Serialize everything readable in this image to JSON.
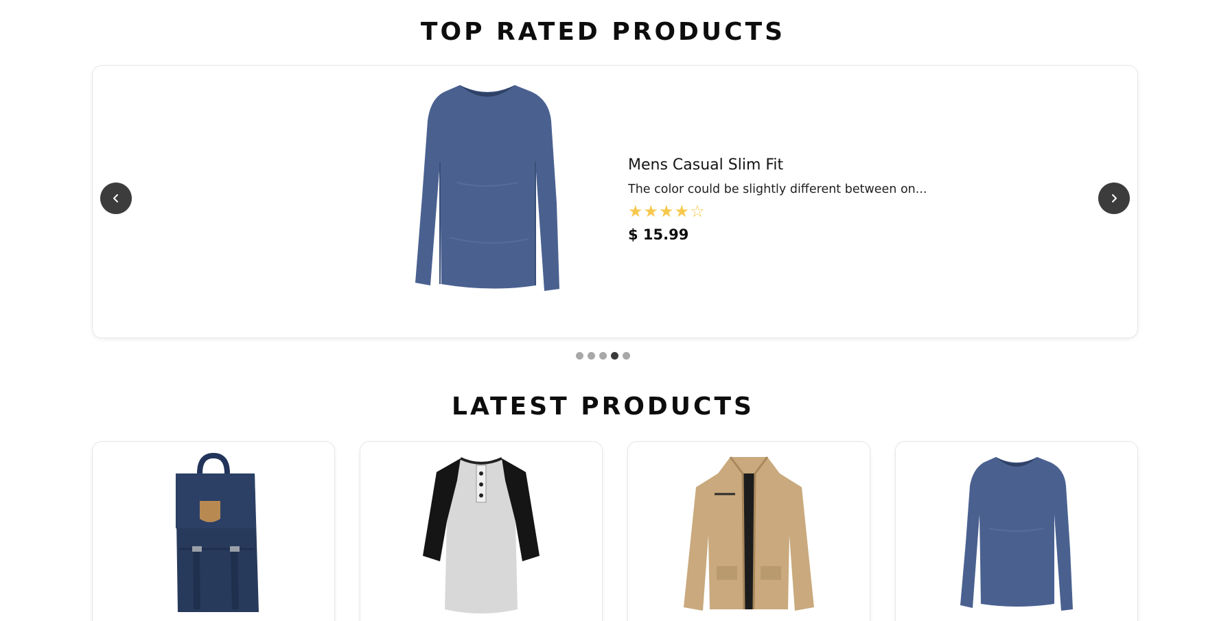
{
  "sections": {
    "top_rated_title": "TOP RATED PRODUCTS",
    "latest_title": "LATEST PRODUCTS"
  },
  "carousel": {
    "product": {
      "name": "Mens Casual Slim Fit",
      "description": "The color could be slightly different between on...",
      "price": "$ 15.99",
      "rating": 4,
      "rating_max": 5,
      "image_icon": "long-sleeve-tshirt-image"
    },
    "prev_icon": "chevron-left-icon",
    "next_icon": "chevron-right-icon",
    "dots_total": 5,
    "active_dot": 4
  },
  "latest_products": [
    {
      "image_icon": "backpack-image"
    },
    {
      "image_icon": "raglan-henley-shirt-image"
    },
    {
      "image_icon": "jacket-image"
    },
    {
      "image_icon": "long-sleeve-tshirt-image"
    }
  ],
  "colors": {
    "star": "#f6c84c",
    "nav_button": "#3c3c3c",
    "dot_active": "#3a3a3a",
    "dot_inactive": "#a8a8a8",
    "shirt_blue": "#4a6190",
    "backpack_navy": "#283a5c",
    "jacket_khaki": "#c9a97d"
  }
}
